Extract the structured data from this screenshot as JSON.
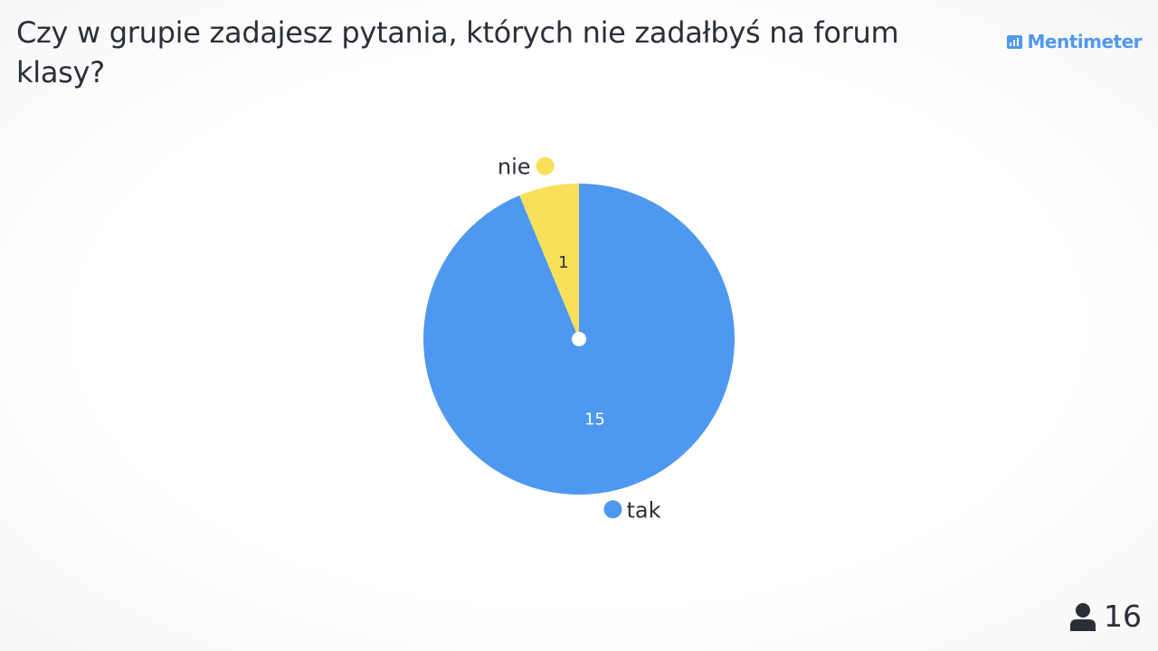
{
  "question": "Czy w grupie zadajesz pytania, których nie zadałbyś na forum klasy?",
  "brand": {
    "name": "Mentimeter",
    "icon": "bar-chart-icon",
    "color": "#4f98ef"
  },
  "participants": {
    "icon": "person-icon",
    "count": "16"
  },
  "chart_data": {
    "type": "pie",
    "categories": [
      "tak",
      "nie"
    ],
    "values": [
      15,
      1
    ],
    "colors": [
      "#4f98ef",
      "#f9e05a"
    ],
    "legend": "labels-outside"
  }
}
